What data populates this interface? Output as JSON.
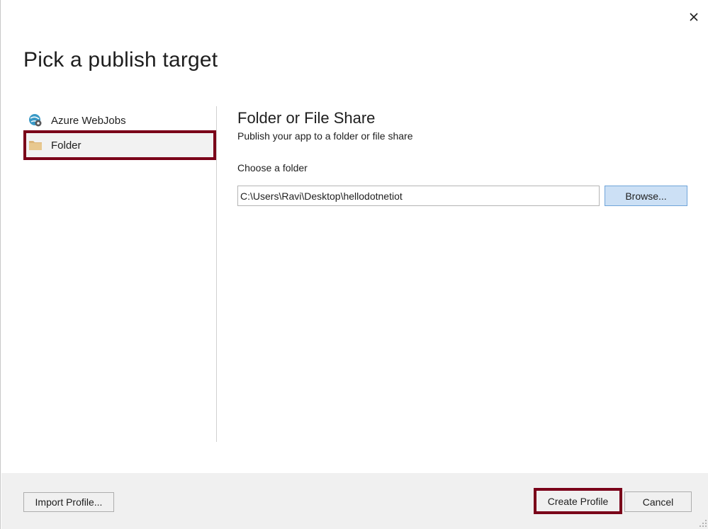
{
  "dialog": {
    "title": "Pick a publish target",
    "close_icon": "close-icon"
  },
  "targets": [
    {
      "label": "Azure WebJobs",
      "icon": "azure-webjobs-icon",
      "selected": false
    },
    {
      "label": "Folder",
      "icon": "folder-icon",
      "selected": true
    }
  ],
  "panel": {
    "title": "Folder or File Share",
    "subtitle": "Publish your app to a folder or file share",
    "choose_label": "Choose a folder",
    "folder_path": "C:\\Users\\Ravi\\Desktop\\hellodotnetiot",
    "browse_label": "Browse..."
  },
  "footer": {
    "import_label": "Import Profile...",
    "create_label": "Create Profile",
    "cancel_label": "Cancel"
  },
  "colors": {
    "highlight_border": "#7a0019",
    "browse_bg": "#cce0f5",
    "footer_bg": "#f0f0f0",
    "folder_icon": "#dcb67a"
  }
}
